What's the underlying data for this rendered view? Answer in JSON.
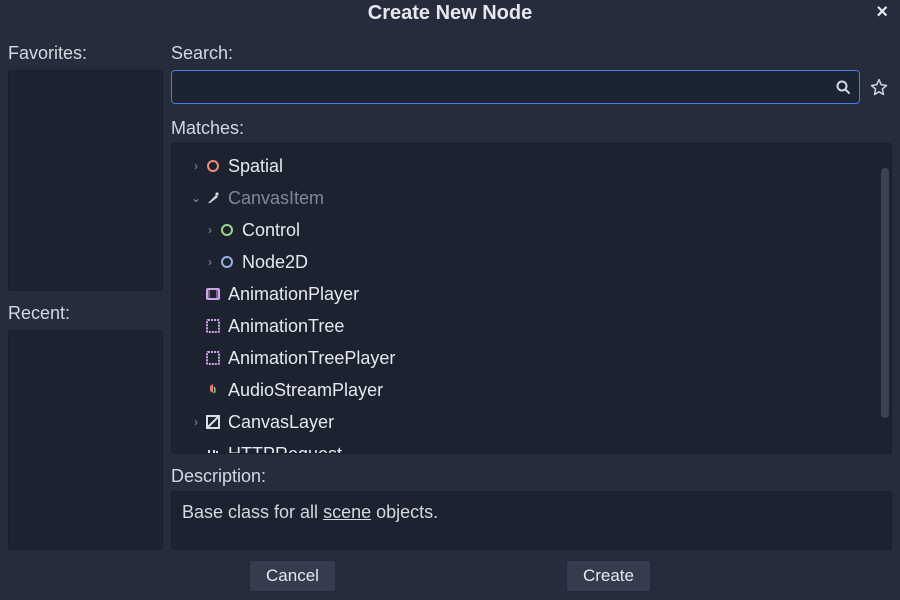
{
  "title": "Create New Node",
  "close": "×",
  "left": {
    "favorites_label": "Favorites:",
    "recent_label": "Recent:"
  },
  "right": {
    "search_label": "Search:",
    "search_value": "",
    "matches_label": "Matches:",
    "description_label": "Description:",
    "description_prefix": "Base class for all ",
    "description_highlight": "scene",
    "description_suffix": " objects."
  },
  "tree": {
    "items": [
      {
        "label": "Spatial"
      },
      {
        "label": "CanvasItem"
      },
      {
        "label": "Control"
      },
      {
        "label": "Node2D"
      },
      {
        "label": "AnimationPlayer"
      },
      {
        "label": "AnimationTree"
      },
      {
        "label": "AnimationTreePlayer"
      },
      {
        "label": "AudioStreamPlayer"
      },
      {
        "label": "CanvasLayer"
      },
      {
        "label": "HTTPRequest"
      }
    ]
  },
  "buttons": {
    "cancel": "Cancel",
    "create": "Create"
  }
}
